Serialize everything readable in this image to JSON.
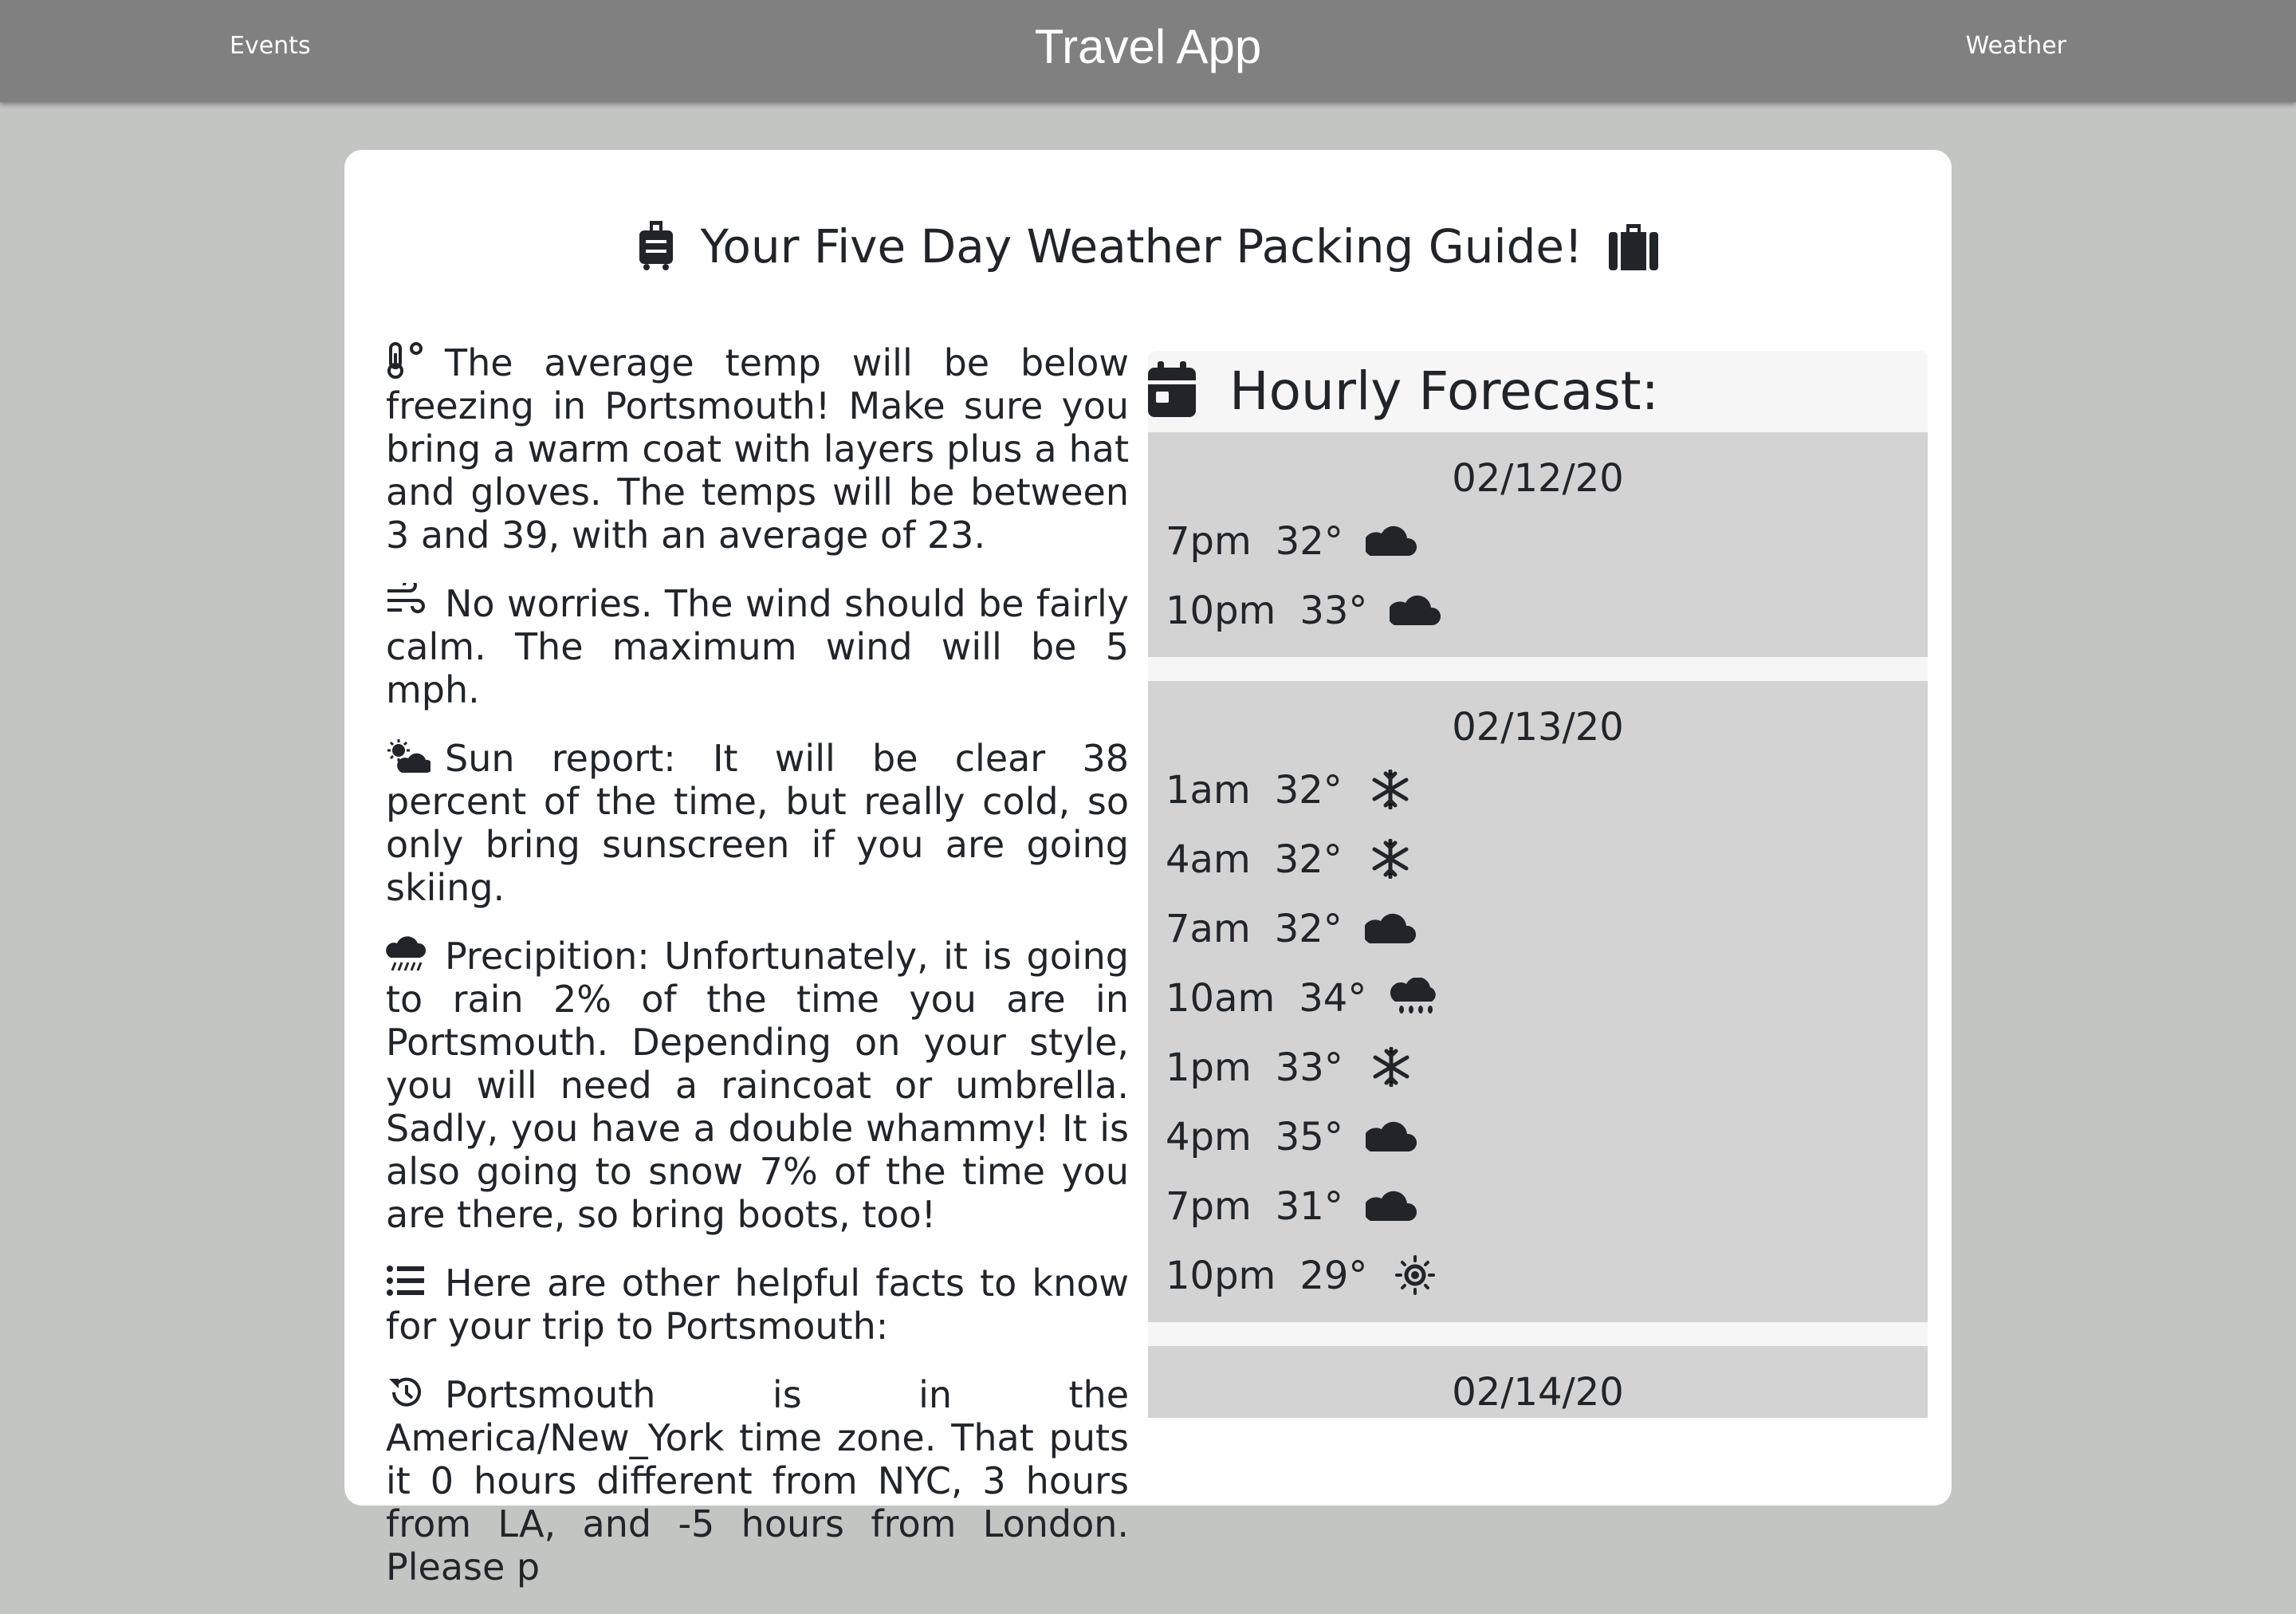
{
  "nav": {
    "left_link": "Events",
    "brand": "Travel App",
    "right_link": "Weather"
  },
  "guide": {
    "title": "Your Five Day Weather Packing Guide!",
    "paragraphs": [
      {
        "icon": "thermometer-icon",
        "text": "The average temp will be below freezing in Portsmouth! Make sure you bring a warm coat with layers plus a hat and gloves. The temps will be between 3 and 39, with an average of 23."
      },
      {
        "icon": "wind-icon",
        "text": "No worries. The wind should be fairly calm. The maximum wind will be 5 mph."
      },
      {
        "icon": "sun-cloud-icon",
        "text": "Sun report: It will be clear 38 percent of the time, but really cold, so only bring sunscreen if you are going skiing."
      },
      {
        "icon": "rain-cloud-icon",
        "text": "Precipition: Unfortunately, it is going to rain 2% of the time you are in Portsmouth. Depending on your style, you will need a raincoat or umbrella. Sadly, you have a double whammy! It is also going to snow 7% of the time you are there, so bring boots, too!"
      },
      {
        "icon": "list-icon",
        "text": "Here are other helpful facts to know for your trip to Portsmouth:"
      },
      {
        "icon": "history-icon",
        "text": "Portsmouth is in the America/New_York time zone. That puts it 0 hours different from NYC, 3 hours from LA, and -5 hours from London. Please p"
      }
    ]
  },
  "forecast": {
    "header": "Hourly Forecast:",
    "days": [
      {
        "date": "02/12/20",
        "hours": [
          {
            "time": "7pm",
            "temp": "32°",
            "icon": "cloud-icon"
          },
          {
            "time": "10pm",
            "temp": "33°",
            "icon": "cloud-icon"
          }
        ]
      },
      {
        "date": "02/13/20",
        "hours": [
          {
            "time": "1am",
            "temp": "32°",
            "icon": "snowflake-icon"
          },
          {
            "time": "4am",
            "temp": "32°",
            "icon": "snowflake-icon"
          },
          {
            "time": "7am",
            "temp": "32°",
            "icon": "cloud-icon"
          },
          {
            "time": "10am",
            "temp": "34°",
            "icon": "rain-icon"
          },
          {
            "time": "1pm",
            "temp": "33°",
            "icon": "snowflake-icon"
          },
          {
            "time": "4pm",
            "temp": "35°",
            "icon": "cloud-icon"
          },
          {
            "time": "7pm",
            "temp": "31°",
            "icon": "cloud-icon"
          },
          {
            "time": "10pm",
            "temp": "29°",
            "icon": "sun-icon"
          }
        ]
      },
      {
        "date": "02/14/20",
        "hours": []
      }
    ]
  }
}
